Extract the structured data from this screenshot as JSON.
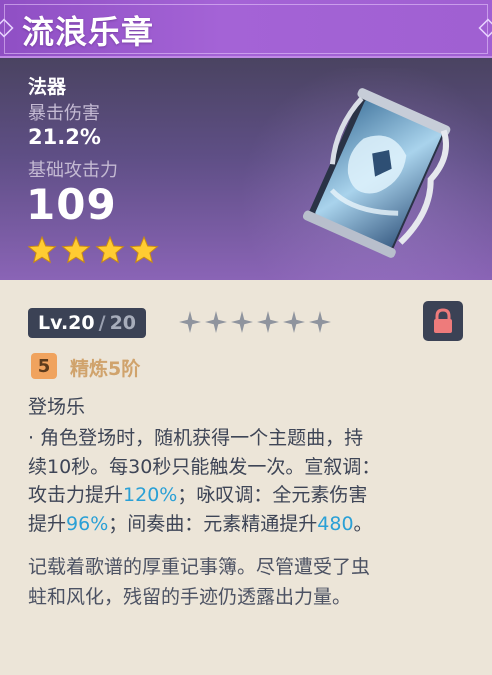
{
  "weapon": {
    "name": "流浪乐章",
    "type": "法器",
    "secondary_stat_name": "暴击伤害",
    "secondary_stat_value": "21.2%",
    "base_atk_name": "基础攻击力",
    "base_atk_value": "109",
    "rarity": 4
  },
  "level": {
    "current": "Lv.20",
    "separator": "/",
    "max": "20",
    "ascension_stars_total": 6,
    "ascension_stars_filled": 0
  },
  "refinement": {
    "rank": "5",
    "label": "精炼5阶"
  },
  "passive": {
    "name": "登场乐",
    "lines": [
      [
        {
          "t": "· 角色登场时，随机获得一个主题曲，持"
        }
      ],
      [
        {
          "t": "续10秒。每30秒只能触发一次。宣叙调："
        }
      ],
      [
        {
          "t": "攻击力提升"
        },
        {
          "t": "120%",
          "h": true
        },
        {
          "t": "；咏叹调：全元素伤害"
        }
      ],
      [
        {
          "t": "提升"
        },
        {
          "t": "96%",
          "h": true
        },
        {
          "t": "；间奏曲：元素精通提升"
        },
        {
          "t": "480",
          "h": true
        },
        {
          "t": "。"
        }
      ]
    ]
  },
  "lore": {
    "lines": [
      "记载着歌谱的厚重记事簿。尽管遭受了虫",
      "蛀和风化，残留的手迹仍透露出力量。"
    ]
  },
  "colors": {
    "title_bar": "#a463d6",
    "header_top": "#4a4361",
    "header_bottom": "#8a64b6",
    "star_gold": "#ffcc32",
    "highlight_blue": "#2aa0d6",
    "refine_gold": "#d0a36c",
    "body_bg": "#ece5d8"
  },
  "icons": [
    "rarity-star-icon",
    "ascension-star-icon",
    "lock-icon",
    "weapon-catalyst-icon",
    "title-corner-ornament-icon"
  ]
}
